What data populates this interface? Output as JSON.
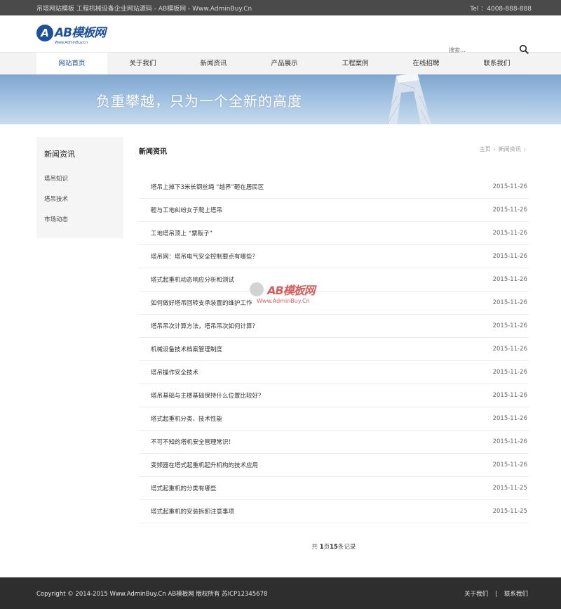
{
  "topbar": {
    "left_text": "吊塔网站模板 工程机械设备企业网站源码 - AB模板网 - Www.AdminBuy.Cn",
    "right_text": "Tel ：4008-888-888"
  },
  "logo": {
    "mark": "A",
    "text": "AB模板网",
    "sub": "Www.AdminBuy.Cn"
  },
  "search": {
    "placeholder": "搜索..."
  },
  "nav": {
    "items": [
      "网站首页",
      "关于我们",
      "新闻资讯",
      "产品展示",
      "工程案例",
      "在线招聘",
      "联系我们"
    ]
  },
  "banner": {
    "slogan": "负重攀越，只为一个全新的高度"
  },
  "sidebar": {
    "title": "新闻资讯",
    "items": [
      "塔吊知识",
      "塔吊技术",
      "市场动态"
    ]
  },
  "main": {
    "title": "新闻资讯",
    "breadcrumb": [
      "主页",
      "新闻资讯"
    ],
    "news": [
      {
        "title": "塔吊上掉下3米长钢丝绳 “越界”砸在居民区",
        "date": "2015-11-26"
      },
      {
        "title": "輕与工地纠纷女子爬上塔吊",
        "date": "2015-11-26"
      },
      {
        "title": "工地塔吊顶上 “票贩子”",
        "date": "2015-11-26"
      },
      {
        "title": "塔吊网：塔吊电气安全控制要点有哪些？",
        "date": "2015-11-26"
      },
      {
        "title": "塔式起重机动态响应分析和测试",
        "date": "2015-11-26"
      },
      {
        "title": "如何做好塔吊回转支承装置的维护工作",
        "date": "2015-11-26"
      },
      {
        "title": "塔吊吊次计算方法，塔吊吊次如何计算？",
        "date": "2015-11-26"
      },
      {
        "title": "机械设备技术档案管理制度",
        "date": "2015-11-26"
      },
      {
        "title": "塔吊操作安全技术",
        "date": "2015-11-26"
      },
      {
        "title": "塔吊基础与主楼基础保持什么位置比较好？",
        "date": "2015-11-26"
      },
      {
        "title": "塔式起重机分类、技术性能",
        "date": "2015-11-26"
      },
      {
        "title": "不可不知的塔机安全管理常识！",
        "date": "2015-11-26"
      },
      {
        "title": "变频器在塔式起重机起升机构的技术应用",
        "date": "2015-11-26"
      },
      {
        "title": "塔式起重机的分类有哪些",
        "date": "2015-11-25"
      },
      {
        "title": "塔式起重机的安装拆卸注意事项",
        "date": "2015-11-25"
      }
    ],
    "pager": {
      "prefix": "共",
      "pages": "1",
      "mid": "页",
      "records": "15",
      "suffix": "条记录"
    }
  },
  "watermark": {
    "text": "AB模板网",
    "sub": "Www.AdminBuy.Cn"
  },
  "footer": {
    "copyright": "Copyright © 2014-2015 Www.AdminBuy.Cn AB模板网 版权所有   苏ICP12345678",
    "links": [
      "关于我们",
      "联系我们"
    ],
    "sep": "|"
  }
}
